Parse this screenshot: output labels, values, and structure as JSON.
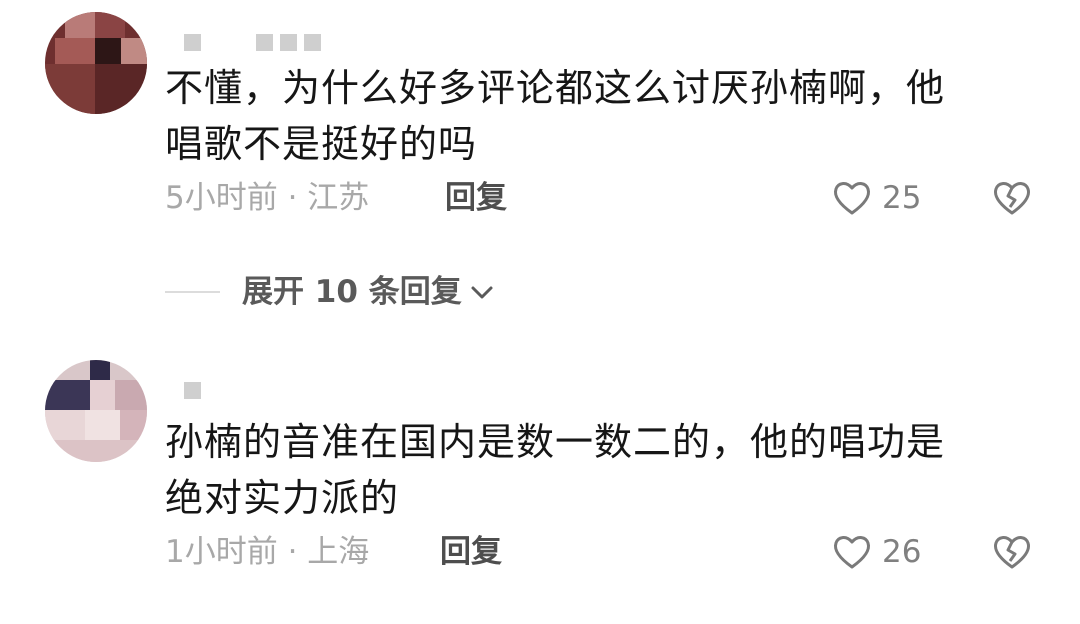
{
  "comments": [
    {
      "text_line1": "不懂，为什么好多评论都这么讨厌孙楠啊，他",
      "text_line2": "唱歌不是挺好的吗",
      "meta": "5小时前 · 江苏",
      "reply_label": "回复",
      "likes": "25",
      "icons": {
        "like": "heart-outline-icon",
        "dislike": "broken-heart-icon"
      }
    },
    {
      "text_line1": "孙楠的音准在国内是数一数二的，他的唱功是",
      "text_line2": "绝对实力派的",
      "meta": "1小时前 · 上海",
      "reply_label": "回复",
      "likes": "26",
      "icons": {
        "like": "heart-outline-icon",
        "dislike": "broken-heart-icon"
      }
    }
  ],
  "expand_replies": {
    "label": "展开 10 条回复",
    "icon": "chevron-down-icon"
  },
  "colors": {
    "text": "#161616",
    "meta": "#a8a8a8",
    "reply": "#4e4e4e",
    "icon": "#7a7a7a"
  }
}
